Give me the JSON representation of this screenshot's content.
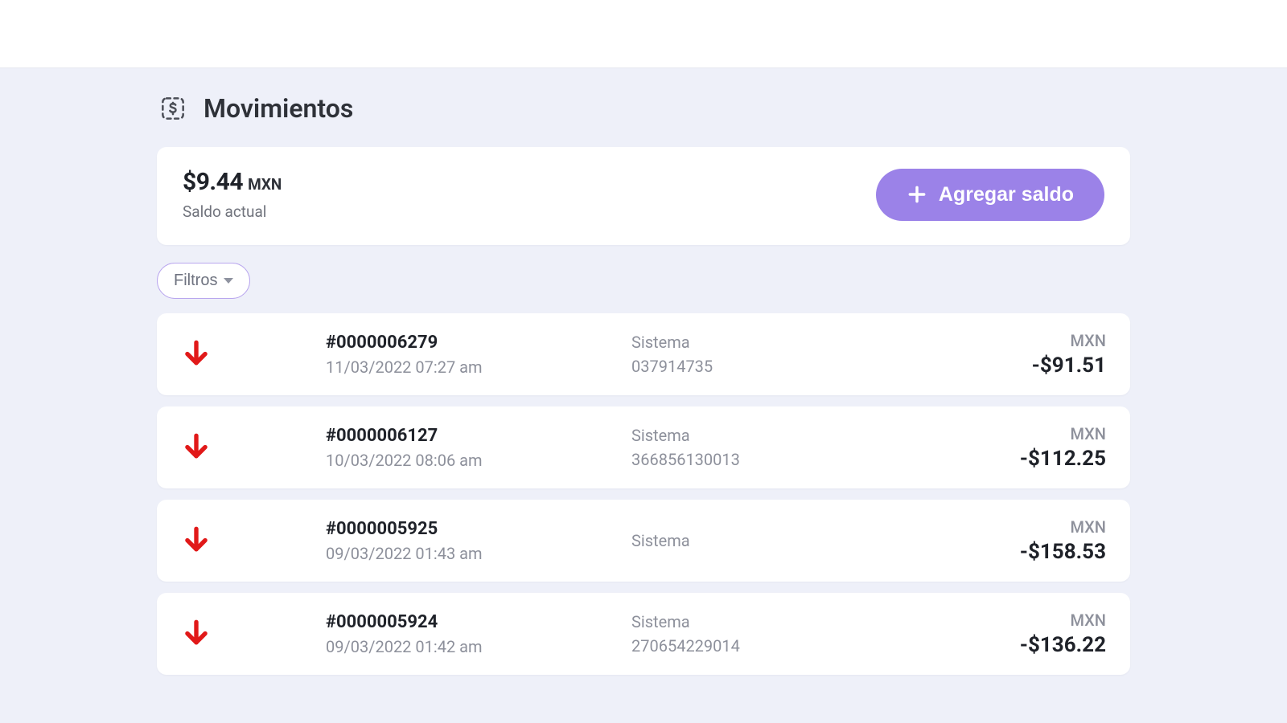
{
  "header": {
    "title": "Movimientos"
  },
  "balance": {
    "amount": "$9.44",
    "currency": "MXN",
    "label": "Saldo actual",
    "add_button": "Agregar saldo"
  },
  "filters": {
    "button_label": "Filtros"
  },
  "transactions": [
    {
      "direction": "down",
      "id": "#0000006279",
      "datetime": "11/03/2022 07:27 am",
      "system_label": "Sistema",
      "system_ref": "037914735",
      "currency": "MXN",
      "amount": "-$91.51"
    },
    {
      "direction": "down",
      "id": "#0000006127",
      "datetime": "10/03/2022 08:06 am",
      "system_label": "Sistema",
      "system_ref": "366856130013",
      "currency": "MXN",
      "amount": "-$112.25"
    },
    {
      "direction": "down",
      "id": "#0000005925",
      "datetime": "09/03/2022 01:43 am",
      "system_label": "Sistema",
      "system_ref": "",
      "currency": "MXN",
      "amount": "-$158.53"
    },
    {
      "direction": "down",
      "id": "#0000005924",
      "datetime": "09/03/2022 01:42 am",
      "system_label": "Sistema",
      "system_ref": "270654229014",
      "currency": "MXN",
      "amount": "-$136.22"
    }
  ],
  "colors": {
    "accent": "#9b82e8",
    "debit_arrow": "#e11919",
    "muted": "#8d909b"
  }
}
